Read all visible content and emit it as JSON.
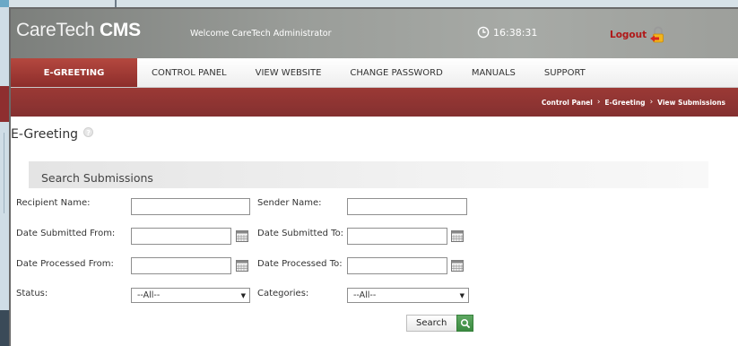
{
  "header": {
    "logo_light": "CareTech",
    "logo_bold": "CMS",
    "welcome": "Welcome CareTech Administrator",
    "clock_time": "16:38:31",
    "logout_label": "Logout",
    "icons": {
      "clock": "clock-icon",
      "logout": "padlock-arrow-icon"
    }
  },
  "nav": {
    "tabs": [
      {
        "label": "E-GREETING",
        "active": true
      },
      {
        "label": "CONTROL PANEL",
        "active": false
      },
      {
        "label": "VIEW WEBSITE",
        "active": false
      },
      {
        "label": "CHANGE PASSWORD",
        "active": false
      },
      {
        "label": "MANUALS",
        "active": false
      },
      {
        "label": "SUPPORT",
        "active": false
      }
    ]
  },
  "breadcrumb": {
    "items": [
      "Control Panel",
      "E-Greeting",
      "View Submissions"
    ],
    "separator": "›"
  },
  "page": {
    "title": "E-Greeting",
    "help_icon": "help-icon"
  },
  "search": {
    "title": "Search Submissions",
    "recipient_name_label": "Recipient Name:",
    "recipient_name_value": "",
    "sender_name_label": "Sender Name:",
    "sender_name_value": "",
    "date_submitted_from_label": "Date Submitted From:",
    "date_submitted_from_value": "",
    "date_submitted_to_label": "Date Submitted To:",
    "date_submitted_to_value": "",
    "date_processed_from_label": "Date Processed From:",
    "date_processed_from_value": "",
    "date_processed_to_label": "Date Processed To:",
    "date_processed_to_value": "",
    "status_label": "Status:",
    "status_value": "--All--",
    "categories_label": "Categories:",
    "categories_value": "--All--",
    "search_button": "Search",
    "calendar_icon": "calendar-icon",
    "search_icon": "magnifier-icon"
  },
  "colors": {
    "brand_red": "#8d2d2b",
    "logout_red": "#b01818",
    "header_grey": "#9a9d99",
    "search_green": "#3b8a40"
  }
}
